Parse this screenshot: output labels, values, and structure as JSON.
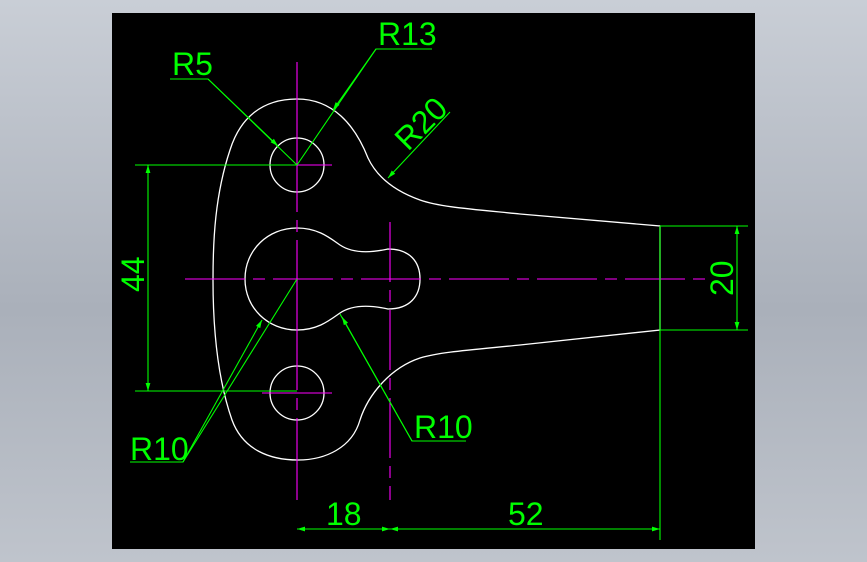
{
  "colors": {
    "background": "#000000",
    "outline": "#ffffff",
    "centerline": "#ff00ff",
    "dimension": "#00ff00"
  },
  "dimensions": {
    "r13": "R13",
    "r5": "R5",
    "r20": "R20",
    "r10_left": "R10",
    "r10_right": "R10",
    "d44": "44",
    "d20": "20",
    "d18": "18",
    "d52": "52"
  }
}
